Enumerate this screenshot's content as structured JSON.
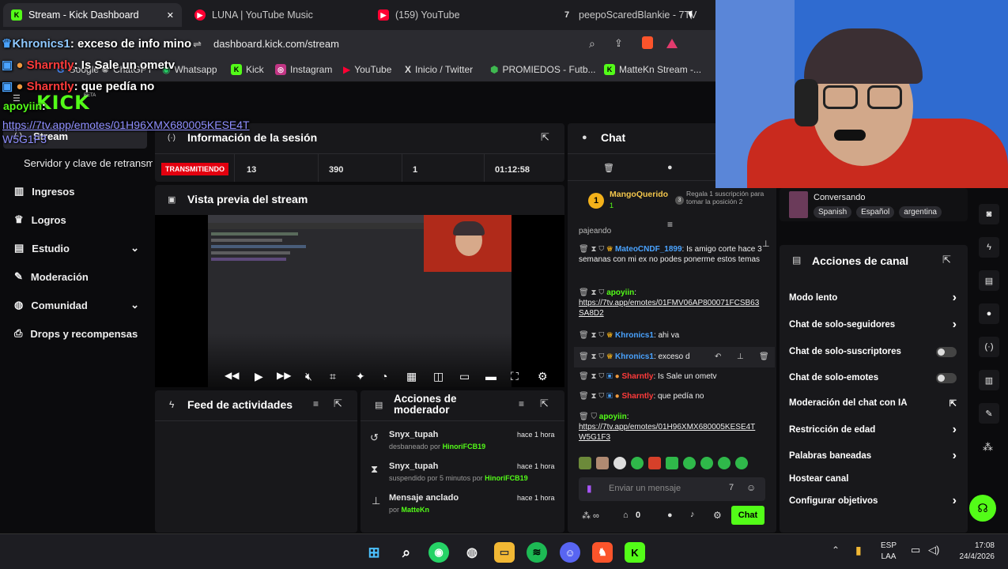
{
  "browser": {
    "tabs": [
      {
        "title": "Stream - Kick Dashboard",
        "icon": "kick-icon",
        "active": true
      },
      {
        "title": "LUNA | YouTube Music",
        "icon": "youtube-music-icon"
      },
      {
        "title": "(159) YouTube",
        "icon": "youtube-icon"
      },
      {
        "title": "peepoScaredBlankie - 7TV",
        "icon": "7tv-icon"
      }
    ],
    "close_glyph": "✕",
    "url": "dashboard.kick.com/stream",
    "bookmarks": [
      "Google",
      "ChatGPT",
      "Whatsapp",
      "Kick",
      "Instagram",
      "YouTube",
      "Inicio / Twitter",
      "PROMIEDOS - Futb...",
      "MatteKn Stream -..."
    ]
  },
  "overlay_chat": [
    {
      "user": "Khronics1",
      "text": ": exceso de info mino"
    },
    {
      "user": "Sharntly",
      "text": ": Is Sale un ometv"
    },
    {
      "user": "Sharntly",
      "text": ": que pedía no"
    },
    {
      "user": "apoyiin",
      "text": ":"
    },
    {
      "link": "https://7tv.app/emotes/01H96XMX680005KESE4T"
    },
    {
      "link": "W5G1F3"
    }
  ],
  "kick": {
    "logo": "KICK",
    "beta": "BETA",
    "sidebar": {
      "stream": "Stream",
      "servidor": "Servidor y clave de retransm",
      "items": [
        "Ingresos",
        "Logros",
        "Estudio",
        "Moderación",
        "Comunidad",
        "Drops y recompensas"
      ]
    },
    "session": {
      "title": "Información de la sesión",
      "status": "TRANSMITIENDO",
      "stats": [
        "13",
        "390",
        "1",
        "01:12:58"
      ]
    },
    "preview": {
      "title": "Vista previa del stream"
    },
    "feed": {
      "title": "Feed de actividades"
    },
    "modactions": {
      "title": "Acciones de moderador",
      "items": [
        {
          "user": "Snyx_tupah",
          "desc": "desbaneado por",
          "by": "HinoriFCB19",
          "time": "hace 1 hora"
        },
        {
          "user": "Snyx_tupah",
          "desc": "suspendido por 5 minutos por",
          "by": "HinoriFCB19",
          "time": "hace 1 hora"
        },
        {
          "user": "Mensaje anclado",
          "desc": "por",
          "by": "MatteKn",
          "time": "hace 1 hora"
        }
      ]
    },
    "chat": {
      "title": "Chat",
      "sub_user": "MangoQuerido",
      "sub_count": "1",
      "sub_badge": "1",
      "gift_badge": "3",
      "gift_text": "Regala 1 suscripción para tomar la posición 2",
      "partial": "pajeando",
      "messages": [
        {
          "user": "MateoCNDF_1899",
          "text": ": Is amigo corte hace 3 semanas con mi ex no podes ponerme estos temas",
          "color": "#4aa3ff"
        },
        {
          "user": "apoyiin",
          "text": ":",
          "link": "https://7tv.app/emotes/01FMV06AP800071FCSB63SA8D2",
          "color": "#53fc18"
        },
        {
          "user": "Khronics1",
          "text": ": ahi va",
          "color": "#4aa3ff"
        },
        {
          "user": "Khronics1",
          "text": ": exceso d",
          "color": "#4aa3ff"
        },
        {
          "user": "Sharntly",
          "text": ": Is Sale un ometv",
          "color": "#ff3b3b"
        },
        {
          "user": "Sharntly",
          "text": ": que pedía no",
          "color": "#ff3b3b"
        },
        {
          "user": "apoyiin",
          "text": ":",
          "link": "https://7tv.app/emotes/01H96XMX680005KESE4TW5G1F3",
          "color": "#53fc18"
        }
      ],
      "placeholder": "Enviar un mensaje",
      "viewers": "0",
      "send": "Chat"
    },
    "channel": {
      "conversando": "Conversando",
      "tags": [
        "Spanish",
        "Español",
        "argentina"
      ],
      "actions_title": "Acciones de canal",
      "actions": [
        "Modo lento",
        "Chat de solo-seguidores",
        "Chat de solo-suscriptores",
        "Chat de solo-emotes",
        "Moderación del chat con IA",
        "Restricción de edad",
        "Palabras baneadas",
        "Hostear canal",
        "Configurar objetivos"
      ]
    }
  },
  "taskbar": {
    "lang": "ESP",
    "lang2": "LAA",
    "time": "17:08",
    "date": "24/4/2026"
  },
  "colors": {
    "kick_green": "#53fc18",
    "live_red": "#e3000f",
    "panel": "#18181b"
  }
}
